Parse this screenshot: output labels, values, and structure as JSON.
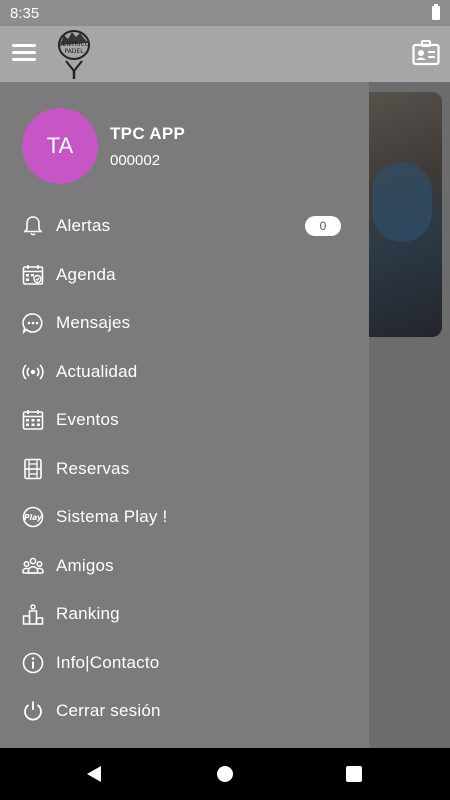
{
  "status": {
    "time": "8:35"
  },
  "header": {
    "logo_text_line1": "CENTRICO",
    "logo_text_line2": "PADEL"
  },
  "profile": {
    "initials": "TA",
    "name": "TPC APP",
    "id": "000002",
    "avatar_color": "#c655c6"
  },
  "menu": {
    "items": [
      {
        "label": "Alertas",
        "icon": "bell-icon",
        "badge": "0"
      },
      {
        "label": "Agenda",
        "icon": "calendar-check-icon"
      },
      {
        "label": "Mensajes",
        "icon": "chat-bubble-icon"
      },
      {
        "label": "Actualidad",
        "icon": "broadcast-icon"
      },
      {
        "label": "Eventos",
        "icon": "calendar-grid-icon"
      },
      {
        "label": "Reservas",
        "icon": "court-icon"
      },
      {
        "label": "Sistema Play !",
        "icon": "play-badge-icon"
      },
      {
        "label": "Amigos",
        "icon": "friends-icon"
      },
      {
        "label": "Ranking",
        "icon": "podium-icon"
      },
      {
        "label": "Info|Contacto",
        "icon": "info-icon"
      },
      {
        "label": "Cerrar sesión",
        "icon": "power-icon"
      }
    ]
  }
}
